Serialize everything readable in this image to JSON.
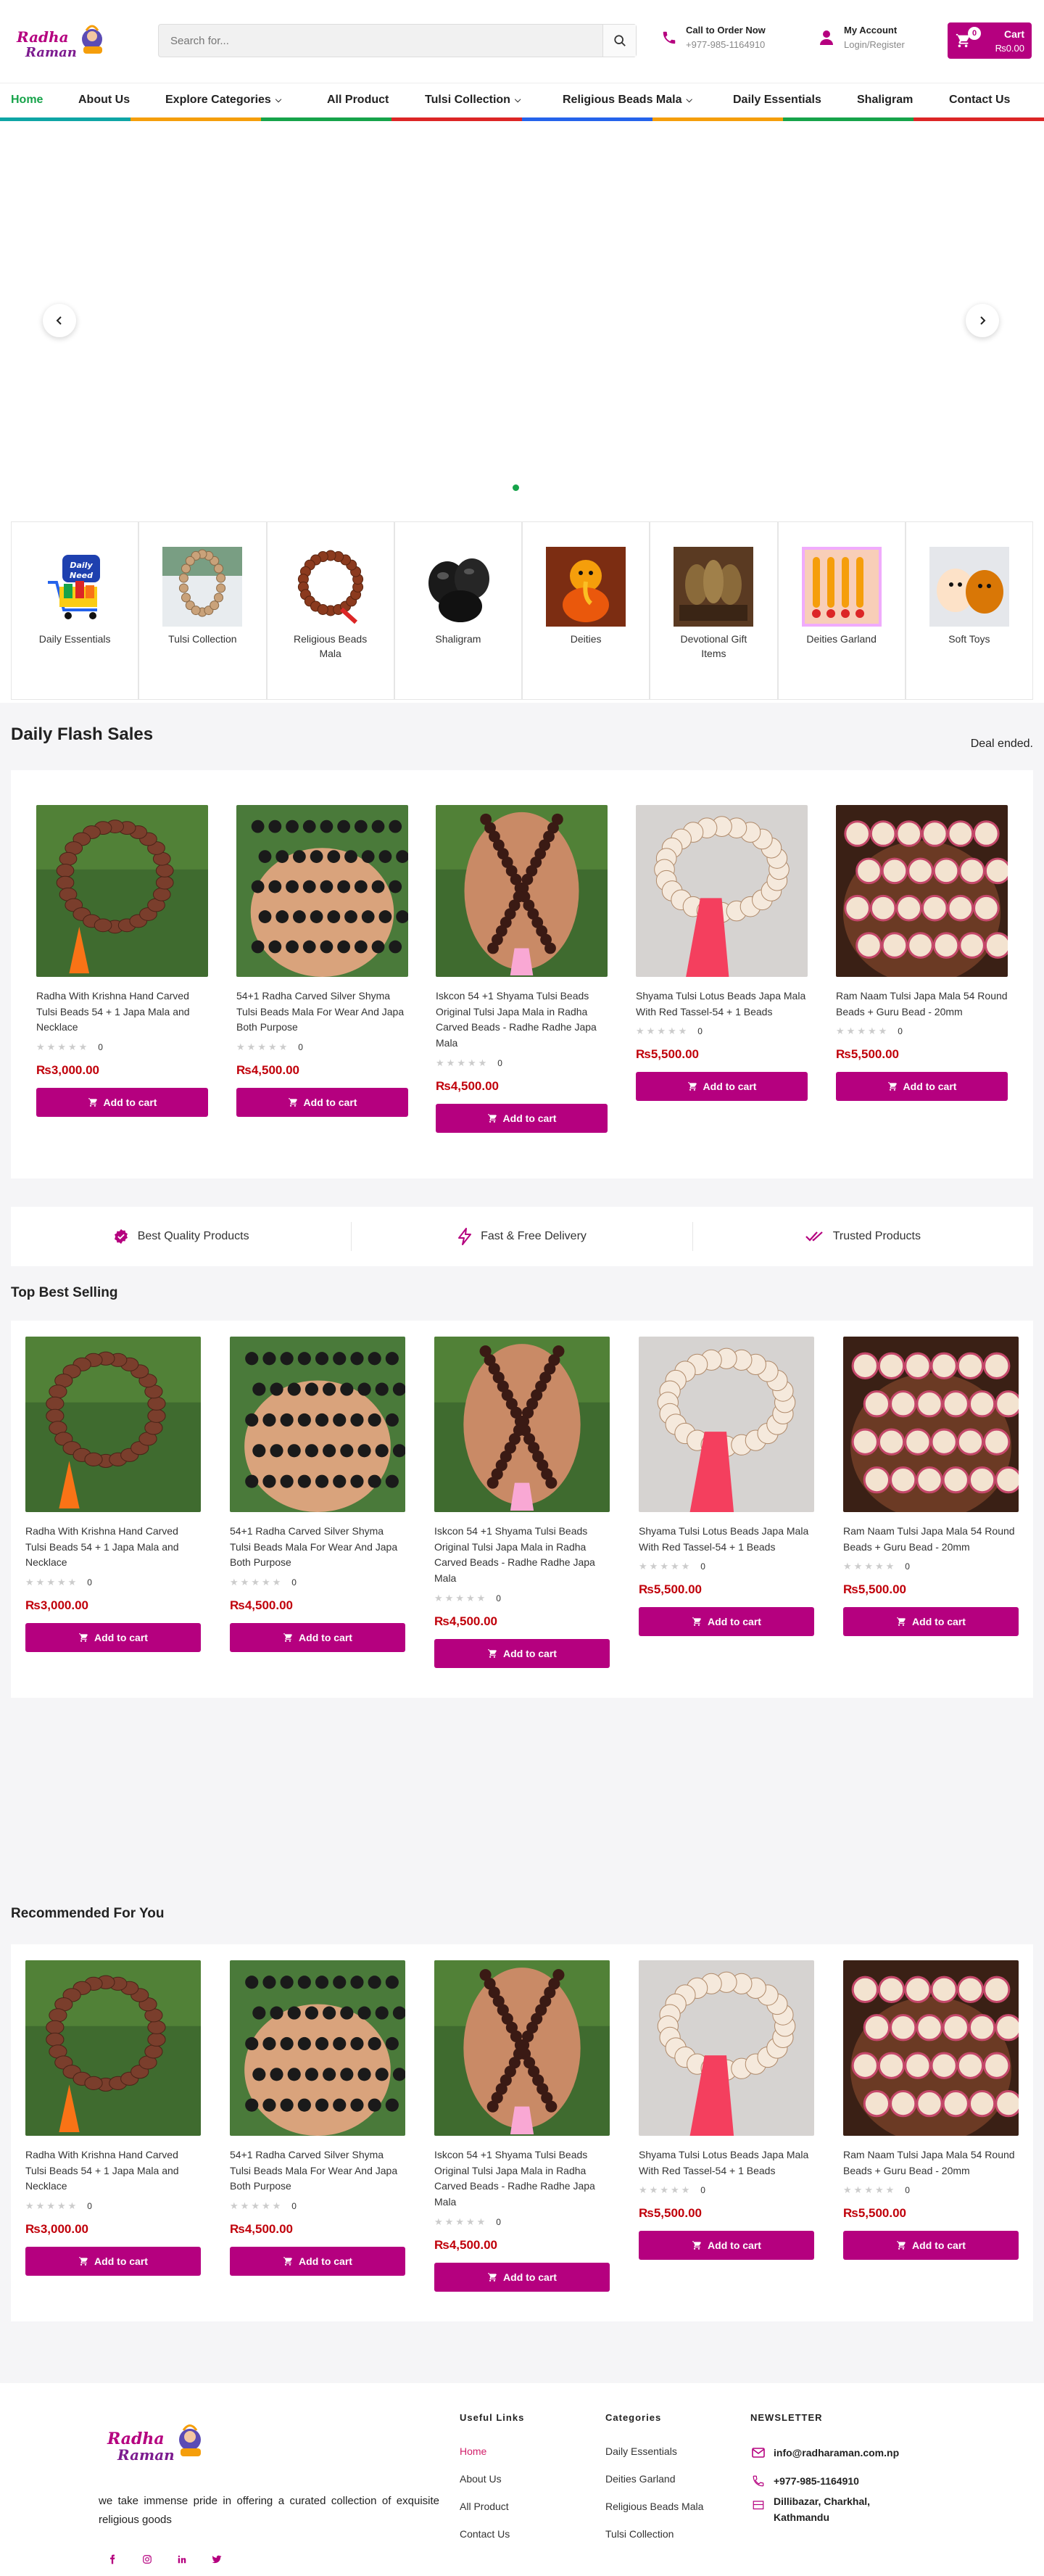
{
  "brand": {
    "logo_text": "Radha Raman",
    "accent": "#b5007f",
    "price_color": "#c0000a",
    "active_nav_color": "#16a34a"
  },
  "header": {
    "search_placeholder": "Search for...",
    "call_label": "Call to Order Now",
    "call_number": "+977-985-1164910",
    "account_label": "My Account",
    "account_sub": "Login/Register",
    "cart_label": "Cart",
    "cart_count": "0",
    "cart_total": "₨0.00"
  },
  "nav": {
    "items": [
      {
        "label": "Home",
        "active": true
      },
      {
        "label": "About Us"
      },
      {
        "label": "Explore Categories",
        "dropdown": true
      },
      {
        "label": "All Product"
      },
      {
        "label": "Tulsi Collection",
        "dropdown": true
      },
      {
        "label": "Religious Beads Mala",
        "dropdown": true
      },
      {
        "label": "Daily Essentials"
      },
      {
        "label": "Shaligram"
      },
      {
        "label": "Contact Us"
      }
    ],
    "stripe_colors": [
      "#0ea5a5",
      "#f59e0b",
      "#16a34a",
      "#dc2626",
      "#2563eb",
      "#f59e0b",
      "#16a34a",
      "#dc2626"
    ]
  },
  "hero": {
    "prev_icon": "chevron-left-icon",
    "next_icon": "chevron-right-icon"
  },
  "categories": [
    {
      "label": "Daily Essentials",
      "icon": "daily-need-cart"
    },
    {
      "label": "Tulsi Collection",
      "icon": "tulsi-mala"
    },
    {
      "label": "Religious Beads Mala",
      "icon": "rudraksha-mala"
    },
    {
      "label": "Shaligram",
      "icon": "shaligram-stones"
    },
    {
      "label": "Deities",
      "icon": "ganesha"
    },
    {
      "label": "Devotional Gift Items",
      "icon": "idol-set"
    },
    {
      "label": "Deities Garland",
      "icon": "garland"
    },
    {
      "label": "Soft Toys",
      "icon": "plush-toys"
    }
  ],
  "flash_sales": {
    "title": "Daily Flash Sales",
    "status": "Deal ended."
  },
  "trust": [
    {
      "label": "Best Quality Products",
      "icon": "badge-check-icon"
    },
    {
      "label": "Fast & Free Delivery",
      "icon": "lightning-icon"
    },
    {
      "label": "Trusted Products",
      "icon": "double-check-icon"
    }
  ],
  "best_selling": {
    "title": "Top Best Selling"
  },
  "recommended": {
    "title": "Recommended For You"
  },
  "product_sets": {
    "flash": [
      {
        "name": "Radha With Krishna Hand Carved Tulsi Beads 54 + 1 Japa Mala and Necklace",
        "reviews": "0",
        "price": "₨3,000.00",
        "button": "Add to cart",
        "img": "brown"
      },
      {
        "name": "54+1 Radha Carved Silver Shyma Tulsi Beads Mala For Wear And Japa Both Purpose",
        "reviews": "0",
        "price": "₨4,500.00",
        "button": "Add to cart",
        "img": "black"
      },
      {
        "name": "Iskcon 54 +1 Shyama Tulsi Beads Original Tulsi Japa Mala in Radha Carved Beads - Radhe Radhe Japa Mala",
        "reviews": "0",
        "price": "₨4,500.00",
        "button": "Add to cart",
        "img": "hand"
      },
      {
        "name": "Shyama Tulsi Lotus Beads Japa Mala With Red Tassel-54 + 1 Beads",
        "reviews": "0",
        "price": "₨5,500.00",
        "button": "Add to cart",
        "img": "lotus"
      },
      {
        "name": "Ram Naam Tulsi Japa Mala 54 Round Beads + Guru Bead - 20mm",
        "reviews": "0",
        "price": "₨5,500.00",
        "button": "Add to cart",
        "img": "ram"
      }
    ]
  },
  "footer": {
    "about": "we take immense pride in offering a curated collection of exquisite religious goods",
    "useful_title": "Useful Links",
    "useful_links": [
      "Home",
      "About Us",
      "All Product",
      "Contact Us"
    ],
    "categories_title": "Categories",
    "category_links": [
      "Daily Essentials",
      "Deities Garland",
      "Religious Beads Mala",
      "Tulsi Collection"
    ],
    "newsletter_title": "NEWSLETTER",
    "email": "info@radharaman.com.np",
    "phone": "+977-985-1164910",
    "address": "Dillibazar, Charkhal, Kathmandu",
    "socials": [
      "facebook-icon",
      "instagram-icon",
      "linkedin-icon",
      "twitter-icon"
    ]
  }
}
